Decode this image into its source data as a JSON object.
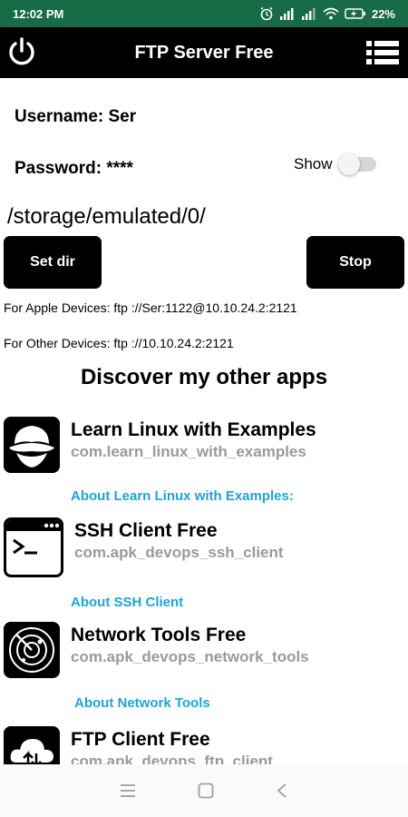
{
  "status_bar": {
    "time": "12:02 PM",
    "battery": "22%",
    "icons": [
      "alarm-icon",
      "signal-icon",
      "signal-icon",
      "wifi-icon",
      "battery-charging-icon"
    ]
  },
  "appbar": {
    "title": "FTP Server Free",
    "left_icon": "power-icon",
    "right_icon": "menu-list-icon"
  },
  "credentials": {
    "username_label": "Username: Ser",
    "password_label": "Password: ****",
    "show_label": "Show",
    "show_enabled": false
  },
  "directory": {
    "path": "/storage/emulated/0/"
  },
  "actions": {
    "set_dir_label": "Set dir",
    "stop_label": "Stop"
  },
  "connection": {
    "apple_line": "For Apple Devices:  ftp ://Ser:1122@10.10.24.2:2121",
    "other_line": "For Other Devices:  ftp ://10.10.24.2:2121"
  },
  "discover_title": "Discover my other apps",
  "apps": [
    {
      "name": "Learn Linux with Examples",
      "package": "com.learn_linux_with_examples",
      "about": "About Learn Linux with Examples:",
      "icon": "linux-hat-icon"
    },
    {
      "name": "SSH Client Free",
      "package": "com.apk_devops_ssh_client",
      "about": "About SSH Client",
      "icon": "terminal-icon"
    },
    {
      "name": "Network Tools Free",
      "package": "com.apk_devops_network_tools",
      "about": "About Network Tools",
      "icon": "radar-icon"
    },
    {
      "name": "FTP Client Free",
      "package": "com.apk_devops_ftp_client",
      "icon": "cloud-transfer-icon"
    }
  ],
  "nav": {
    "icons": [
      "recents-icon",
      "home-icon",
      "back-icon"
    ]
  },
  "colors": {
    "status_bar": "#176b46",
    "link": "#1fa3d6",
    "package_text": "#9a9a9a"
  }
}
